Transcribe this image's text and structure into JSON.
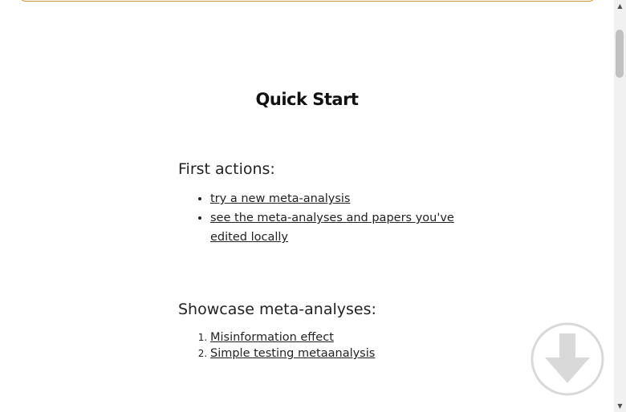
{
  "page": {
    "title": "Quick Start"
  },
  "first_actions": {
    "heading": "First actions:",
    "links": [
      {
        "label": "try a new meta-analysis"
      },
      {
        "label": "see the meta-analyses and papers you've edited locally"
      }
    ]
  },
  "showcase": {
    "heading": "Showcase meta-analyses:",
    "items": [
      {
        "label": "Misinformation effect"
      },
      {
        "label": "Simple testing metaanalysis"
      }
    ]
  },
  "icons": {
    "scroll_button": "arrow-down-circle-icon"
  },
  "colors": {
    "accent_border": "#c8922e",
    "icon_gray": "#d9d9d9"
  }
}
